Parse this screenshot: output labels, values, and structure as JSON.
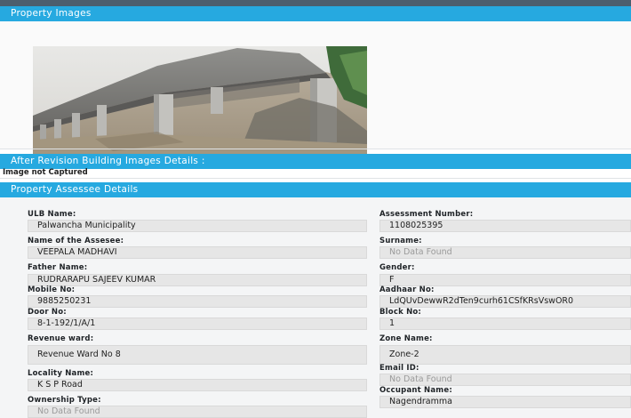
{
  "sections": {
    "property_images": "Property Images",
    "after_revision": "After Revision Building Images Details :",
    "image_status": "Image not Captured",
    "assessee_details": "Property Assessee Details"
  },
  "fields_left": [
    {
      "label": "ULB Name:",
      "value": "Palwancha Municipality"
    },
    {
      "label": "Name of the Assesee:",
      "value": "VEEPALA MADHAVI"
    },
    {
      "label": "Father Name:",
      "value": "RUDRARAPU SAJEEV KUMAR"
    },
    {
      "label": "Mobile No:",
      "value": "9885250231"
    },
    {
      "label": "Door No:",
      "value": "8-1-192/1/A/1"
    },
    {
      "label": "Revenue ward:",
      "value": "Revenue Ward No  8"
    },
    {
      "label": "Locality Name:",
      "value": "K S P Road"
    },
    {
      "label": "Ownership Type:",
      "value": "No Data Found"
    }
  ],
  "fields_right": [
    {
      "label": "Assessment Number:",
      "value": "1108025395"
    },
    {
      "label": "Surname:",
      "value": "No Data Found"
    },
    {
      "label": "Gender:",
      "value": "F"
    },
    {
      "label": "Aadhaar No:",
      "value": "LdQUvDewwR2dTen9curh61CSfKRsVswOR0"
    },
    {
      "label": "Block No:",
      "value": "1"
    },
    {
      "label": "Zone Name:",
      "value": "Zone-2"
    },
    {
      "label": "Email ID:",
      "value": "No Data Found"
    },
    {
      "label": "Occupant Name:",
      "value": "Nagendramma"
    }
  ]
}
